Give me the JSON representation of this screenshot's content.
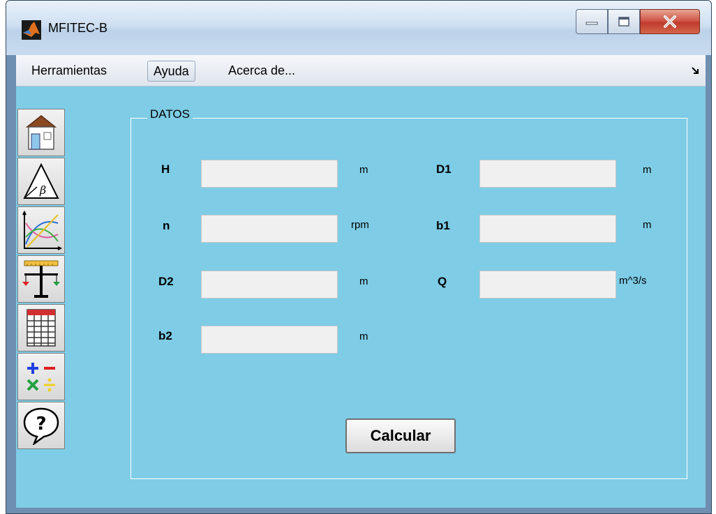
{
  "window": {
    "title": "MFITEC-B"
  },
  "menu": {
    "items": [
      "Herramientas",
      "Ayuda",
      "Acerca de..."
    ],
    "overflow_icon": "chevron-down-right-icon"
  },
  "toolbar": {
    "icons": [
      "home-icon",
      "triangle-beta-icon",
      "graph-icon",
      "balance-icon",
      "table-icon",
      "operations-icon",
      "help-bubble-icon"
    ]
  },
  "panel": {
    "title": "DATOS",
    "fields": {
      "H": {
        "label": "H",
        "value": "",
        "unit": "m"
      },
      "n": {
        "label": "n",
        "value": "",
        "unit": "rpm"
      },
      "D2": {
        "label": "D2",
        "value": "",
        "unit": "m"
      },
      "b2": {
        "label": "b2",
        "value": "",
        "unit": "m"
      },
      "D1": {
        "label": "D1",
        "value": "",
        "unit": "m"
      },
      "b1": {
        "label": "b1",
        "value": "",
        "unit": "m"
      },
      "Q": {
        "label": "Q",
        "value": "",
        "unit": "m^3/s"
      }
    },
    "calc_label": "Calcular"
  },
  "colors": {
    "background": "#7ecce6",
    "panel_border": "#ffffff",
    "field_bg": "#f0f0f0"
  }
}
